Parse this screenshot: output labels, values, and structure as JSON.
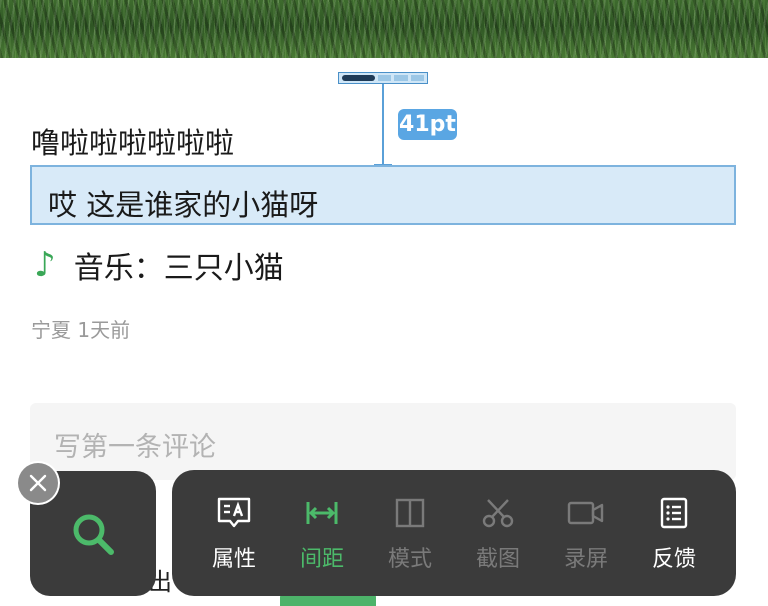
{
  "post": {
    "line1": "噜啦啦啦啦啦啦",
    "line2": "哎 这是谁家的小猫呀",
    "music_prefix": "音乐：",
    "music_title": "三只小猫",
    "location": "宁夏",
    "time": "1天前"
  },
  "measure": {
    "value": "41pt"
  },
  "comment": {
    "placeholder": "写第一条评论"
  },
  "toolbar": {
    "items": [
      {
        "label": "属性",
        "icon": "properties-icon",
        "state": "normal"
      },
      {
        "label": "间距",
        "icon": "spacing-icon",
        "state": "active"
      },
      {
        "label": "模式",
        "icon": "mode-icon",
        "state": "disabled"
      },
      {
        "label": "截图",
        "icon": "screenshot-icon",
        "state": "disabled"
      },
      {
        "label": "录屏",
        "icon": "record-icon",
        "state": "disabled"
      },
      {
        "label": "反馈",
        "icon": "feedback-icon",
        "state": "normal"
      }
    ]
  },
  "colors": {
    "accent_green": "#4cba6a",
    "measure_blue": "#5aa6e3",
    "panel_dark": "#3b3b3b"
  },
  "strip": {
    "partial_text": "出"
  }
}
